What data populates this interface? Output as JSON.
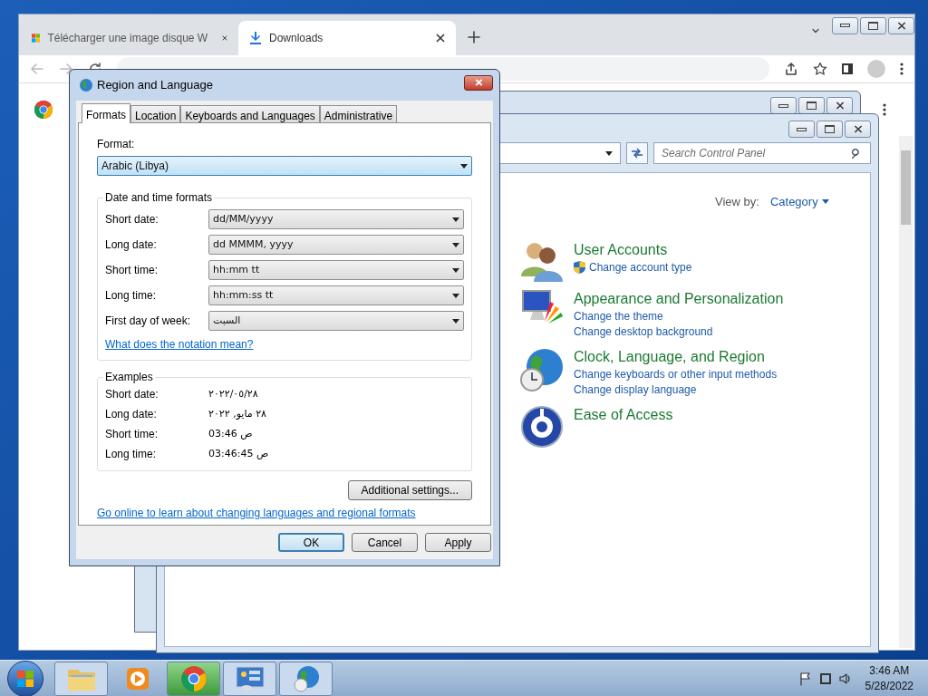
{
  "browser": {
    "tabs": [
      {
        "title": "Télécharger une image disque W",
        "selected": false
      },
      {
        "title": "Downloads",
        "selected": true
      }
    ]
  },
  "control_panel": {
    "search": {
      "placeholder": "Search Control Panel"
    },
    "view_by": {
      "label": "View by:",
      "value": "Category"
    },
    "categories": [
      {
        "kind": "users",
        "title": "User Accounts",
        "links": [
          {
            "text": "Change account type",
            "shield": true
          }
        ]
      },
      {
        "kind": "appearance",
        "title": "Appearance and Personalization",
        "links": [
          {
            "text": "Change the theme",
            "shield": false
          },
          {
            "text": "Change desktop background",
            "shield": false
          }
        ]
      },
      {
        "kind": "clock",
        "title": "Clock, Language, and Region",
        "links": [
          {
            "text": "Change keyboards or other input methods",
            "shield": false
          },
          {
            "text": "Change display language",
            "shield": false
          }
        ]
      },
      {
        "kind": "access",
        "title": "Ease of Access"
      }
    ]
  },
  "dialog": {
    "title": "Region and Language",
    "tabs": [
      {
        "label": "Formats",
        "selected": true
      },
      {
        "label": "Location",
        "selected": false
      },
      {
        "label": "Keyboards and Languages",
        "selected": false
      },
      {
        "label": "Administrative",
        "selected": false
      }
    ],
    "format": {
      "label": "Format:",
      "value": "Arabic (Libya)",
      "focused": true
    },
    "date_time_group": {
      "title": "Date and time formats",
      "rows": [
        {
          "label": "Short date:",
          "value": "dd/MM/yyyy"
        },
        {
          "label": "Long date:",
          "value": "dd MMMM, yyyy"
        },
        {
          "label": "Short time:",
          "value": "hh:mm tt"
        },
        {
          "label": "Long time:",
          "value": "hh:mm:ss tt"
        },
        {
          "label": "First day of week:",
          "value": "السبت"
        }
      ],
      "link": "What does the notation mean?"
    },
    "examples": {
      "title": "Examples",
      "rows": [
        {
          "label": "Short date:",
          "value": "٢٠٢٢/٠٥/٢٨"
        },
        {
          "label": "Long date:",
          "value": "٢٨ مايو, ٢٠٢٢"
        },
        {
          "label": "Short time:",
          "value": "03:46 ص"
        },
        {
          "label": "Long time:",
          "value": "03:46:45 ص"
        }
      ]
    },
    "additional_button": "Additional settings...",
    "online_link": "Go online to learn about changing languages and regional formats",
    "buttons": [
      {
        "label": "OK",
        "default": true
      },
      {
        "label": "Cancel",
        "default": false
      },
      {
        "label": "Apply",
        "default": false
      }
    ]
  },
  "taskbar": {
    "apps": [
      {
        "kind": "explorer",
        "open": true,
        "selected": false
      },
      {
        "kind": "media",
        "open": false,
        "selected": false
      },
      {
        "kind": "chrome",
        "open": true,
        "selected": true
      },
      {
        "kind": "control",
        "open": true,
        "selected": false
      },
      {
        "kind": "globe",
        "open": true,
        "selected": false
      }
    ],
    "clock": {
      "time": "3:46 AM",
      "date": "5/28/2022"
    }
  }
}
